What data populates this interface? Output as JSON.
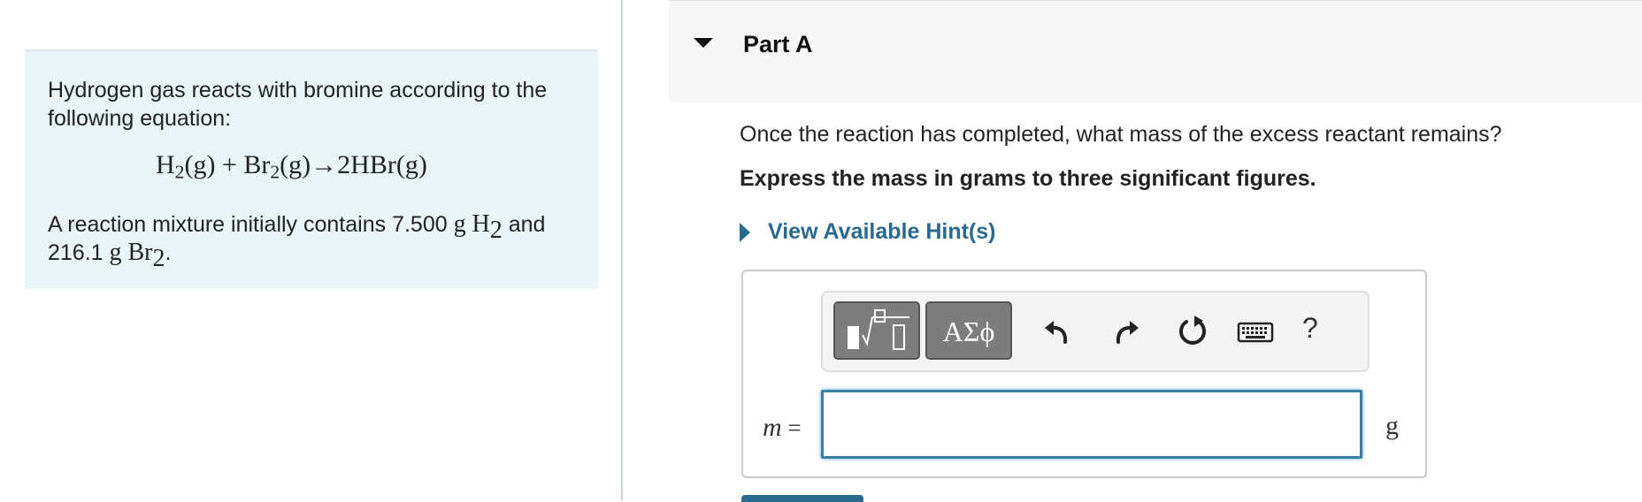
{
  "problem": {
    "intro": "Hydrogen gas reacts with bromine according to the following equation:",
    "equation": {
      "h": "H",
      "h_sub": "2",
      "g1": "(g)",
      "plus": " + ",
      "br": "Br",
      "br_sub": "2",
      "g2": "(g)",
      "arrow": "→",
      "product": "2HBr",
      "g3": "(g)"
    },
    "mixture": {
      "prefix": "A reaction mixture initially contains 7.500 ",
      "unit1": "g",
      "h": "H",
      "h_sub": "2",
      "mid": " and 216.1 ",
      "unit2": "g",
      "br": "Br",
      "br_sub": "2",
      "end": "."
    }
  },
  "part": {
    "title": "Part A"
  },
  "question": {
    "text": "Once the reaction has completed, what mass of the excess reactant remains?",
    "instruction": "Express the mass in grams to three significant figures."
  },
  "hint": {
    "label": "View Available Hint(s)"
  },
  "toolbar": {
    "symbols_label": "ΑΣϕ",
    "help_label": "?"
  },
  "answer": {
    "variable": "m",
    "equals": "=",
    "value": "",
    "unit": "g"
  },
  "colors": {
    "problem_bg": "#eaf5f7",
    "link": "#2b6a8f",
    "input_border": "#3d7ea6",
    "button_gray": "#7d7d7d"
  }
}
